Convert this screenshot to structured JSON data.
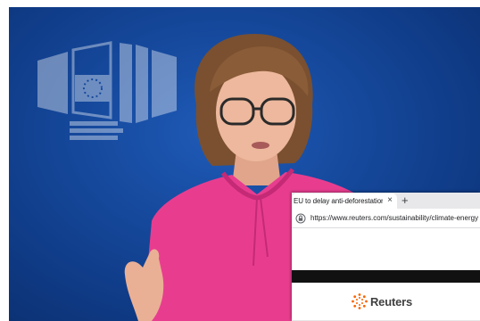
{
  "browser": {
    "tab_title": "EU to delay anti-deforestation la",
    "tab_close": "×",
    "new_tab": "+",
    "url": "https://www.reuters.com/sustainability/climate-energy"
  },
  "site": {
    "brand_name": "Reuters"
  },
  "icons": {
    "lock": "lock-icon",
    "reuters_mark": "reuters-logo-icon"
  },
  "colors": {
    "backdrop_blue": "#164a9e",
    "blouse_pink": "#e83d8f",
    "reuters_orange": "#fa6400"
  }
}
